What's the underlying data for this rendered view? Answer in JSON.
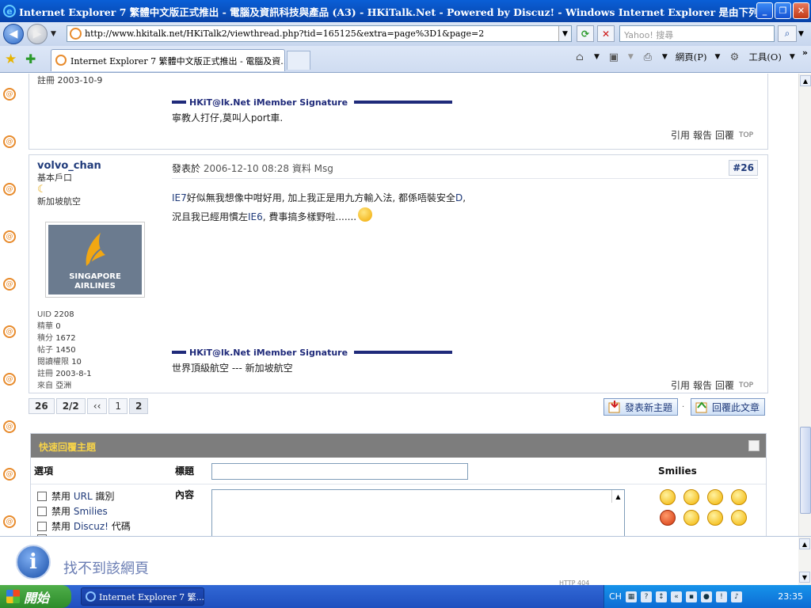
{
  "window": {
    "title": "Internet Explorer 7 繁體中文版正式推出 - 電腦及資訊科技與產品 (A3) - HKiTalk.Net - Powered by Discuz! - Windows Internet Explorer 是由下列提供: Yahoo! H",
    "minimize": "_",
    "maximize": "❐",
    "close": "✕"
  },
  "address": {
    "url": "http://www.hkitalk.net/HKiTalk2/viewthread.php?tid=165125&extra=page%3D1&page=2",
    "search_placeholder": "Yahoo! 搜尋"
  },
  "tabs": [
    {
      "label": "Internet Explorer 7 繁體中文版正式推出 - 電腦及資..."
    }
  ],
  "toolbar": {
    "home": "⌂",
    "feeds": "▣",
    "print": "⎙",
    "page_label": "網頁(P)",
    "tools_label": "工具(O)",
    "more": "»"
  },
  "prev_post": {
    "registered_label": "註冊",
    "registered": "2003-10-9",
    "sig_title": "HKiT@lk.Net iMember Signature",
    "sig_text": "寧教人打仔,莫叫人port車.",
    "actions": [
      "引用",
      "報告",
      "回覆"
    ],
    "top": "TOP"
  },
  "post": {
    "author": "volvo_chan",
    "group": "基本戶口",
    "location_label": "新加坡航空",
    "avatar_text": "SINGAPORE\nAIRLINES",
    "uid_label": "UID",
    "uid": "2208",
    "digest_label": "精華",
    "digest": "0",
    "points_label": "積分",
    "points": "1672",
    "posts_label": "帖子",
    "posts": "1450",
    "read_perm_label": "閱讀權限",
    "read_perm": "10",
    "reg_label": "註冊",
    "reg": "2003-8-1",
    "from_label": "來自",
    "from": "亞洲",
    "posted_prefix": "發表於",
    "posted_at": "2006-12-10 08:28",
    "profile_link": "資料",
    "msg_link": "Msg",
    "floor": "#26",
    "line1_a": "IE7",
    "line1_b": "好似無我想像中咁好用, 加上我正是用九方輸入法, 都係唔裝安全",
    "line1_c": "D",
    "line1_d": ",",
    "line2_a": "況且我已經用慣左",
    "line2_b": "IE6",
    "line2_c": ", 費事搞多樣野啦.......",
    "sig_title": "HKiT@lk.Net iMember Signature",
    "sig_text": "世界頂級航空 --- 新加坡航空",
    "actions": [
      "引用",
      "報告",
      "回覆"
    ],
    "top": "TOP"
  },
  "pager": {
    "total": "26",
    "pages": "2/2",
    "prev": "‹‹",
    "p1": "1",
    "p2": "2"
  },
  "buttons": {
    "new_topic": "發表新主題",
    "reply": "回覆此文章"
  },
  "quick_reply": {
    "header": "快速回覆主題",
    "options_label": "選項",
    "title_label": "標題",
    "content_label": "內容",
    "smilies_label": "Smilies",
    "opt1_pre": "禁用",
    "opt1_hl": "URL",
    "opt1_post": "識別",
    "opt2_pre": "禁用",
    "opt2_hl": "Smilies",
    "opt3_pre": "禁用",
    "opt3_hl": "Discuz!",
    "opt3_post": "代碼"
  },
  "infobar": {
    "text": "找不到該網頁",
    "fragment": "HTTP 404"
  },
  "taskbar": {
    "start": "開始",
    "task": "Internet Explorer 7 繁...",
    "lang": "CH",
    "clock": "23:35"
  }
}
